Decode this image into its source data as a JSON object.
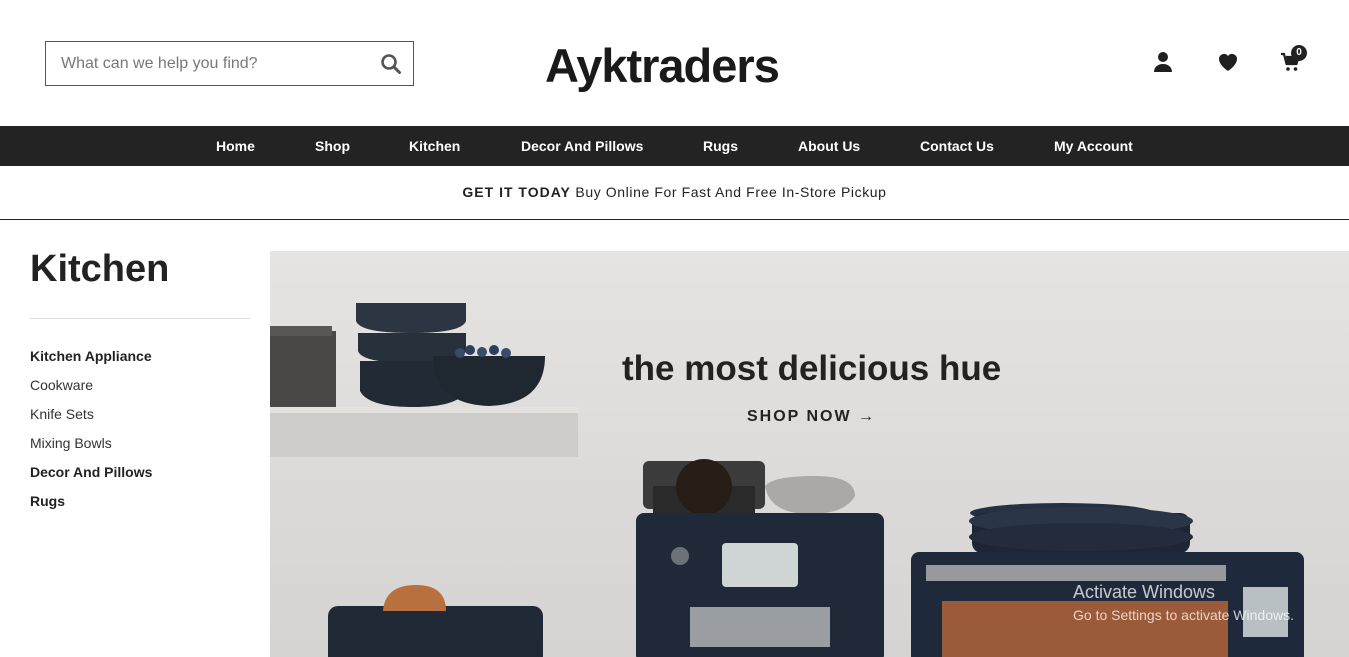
{
  "search": {
    "placeholder": "What can we help you find?"
  },
  "brand": {
    "logo_text": "Ayktraders"
  },
  "header_icons": [
    "user-icon",
    "heart-icon",
    "cart-icon"
  ],
  "cart": {
    "count": "0"
  },
  "nav": {
    "items": [
      {
        "label": "Home"
      },
      {
        "label": "Shop"
      },
      {
        "label": "Kitchen"
      },
      {
        "label": "Decor And Pillows"
      },
      {
        "label": "Rugs"
      },
      {
        "label": "About Us"
      },
      {
        "label": "Contact Us"
      },
      {
        "label": "My Account"
      }
    ]
  },
  "promo": {
    "bold": "GET IT TODAY",
    "text": " Buy Online For Fast And Free In-Store Pickup"
  },
  "sidebar": {
    "title": "Kitchen",
    "items": [
      {
        "label": "Kitchen Appliance",
        "bold": true
      },
      {
        "label": "Cookware",
        "bold": false
      },
      {
        "label": "Knife Sets",
        "bold": false
      },
      {
        "label": "Mixing Bowls",
        "bold": false
      },
      {
        "label": "Decor And Pillows",
        "bold": true
      },
      {
        "label": "Rugs",
        "bold": true
      }
    ]
  },
  "hero": {
    "title": "the most delicious hue",
    "cta": "SHOP NOW →"
  },
  "watermark": {
    "line1": "Activate Windows",
    "line2": "Go to Settings to activate Windows."
  },
  "colors": {
    "nav_bg": "#232323",
    "text": "#222222",
    "accent": "#1a1a1a"
  }
}
